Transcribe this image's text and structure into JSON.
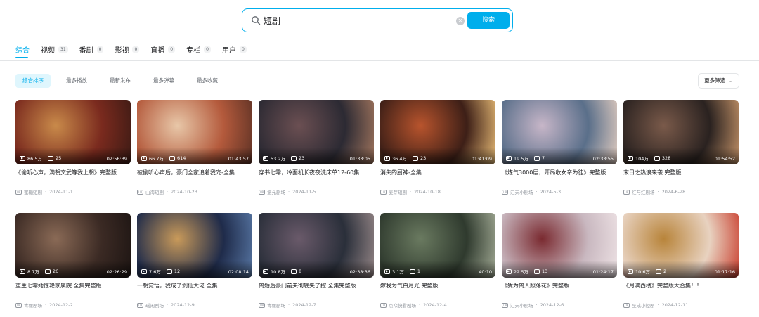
{
  "search": {
    "query": "短剧",
    "button_label": "搜索"
  },
  "tabs": [
    {
      "label": "综合",
      "count": ""
    },
    {
      "label": "视频",
      "count": "31"
    },
    {
      "label": "番剧",
      "count": "0"
    },
    {
      "label": "影视",
      "count": "0"
    },
    {
      "label": "直播",
      "count": "0"
    },
    {
      "label": "专栏",
      "count": "0"
    },
    {
      "label": "用户",
      "count": "0"
    }
  ],
  "sort_options": [
    "综合排序",
    "最多播放",
    "最新发布",
    "最多弹幕",
    "最多收藏"
  ],
  "more_filter_label": "更多筛选",
  "colors": {
    "accent": "#00aeec",
    "text": "#18191c",
    "muted": "#9499a0"
  },
  "videos": [
    {
      "views": "86.5万",
      "danmaku": "25",
      "duration": "02:56:39",
      "title": "《偷听心声，满朝文武等我上朝》完整版",
      "uploader": "蜜糖短剧",
      "date": "2024-11-1"
    },
    {
      "views": "66.7万",
      "danmaku": "614",
      "duration": "01:43:57",
      "title": "被偷听心声后，豪门全家追着我宠-全集",
      "uploader": "山海短剧",
      "date": "2024-10-23"
    },
    {
      "views": "53.2万",
      "danmaku": "23",
      "duration": "01:33:05",
      "title": "穿书七零，冷面机长夜夜洗床单12-60集",
      "uploader": "振允剧场",
      "date": "2024-11-5"
    },
    {
      "views": "36.4万",
      "danmaku": "23",
      "duration": "01:41:09",
      "title": "消失的厨神-全集",
      "uploader": "麦芽短剧",
      "date": "2024-10-18"
    },
    {
      "views": "19.5万",
      "danmaku": "7",
      "duration": "02:33:55",
      "title": "《炼气3000层，开局收女帝为徒》完整版",
      "uploader": "汇天小剧场",
      "date": "2024-5-3"
    },
    {
      "views": "104万",
      "danmaku": "328",
      "duration": "01:54:52",
      "title": "末日之热浪来袭 完整版",
      "uploader": "红与红剧场",
      "date": "2024-6-28"
    },
    {
      "views": "8.7万",
      "danmaku": "26",
      "duration": "02:26:29",
      "title": "重生七零她惊艳家属院 全集完整版",
      "uploader": "青稞剧场",
      "date": "2024-12-2"
    },
    {
      "views": "7.6万",
      "danmaku": "12",
      "duration": "02:08:14",
      "title": "一朝觉悟，我成了剑仙大佬 全集",
      "uploader": "瑶闲剧场",
      "date": "2024-12-9"
    },
    {
      "views": "10.8万",
      "danmaku": "8",
      "duration": "02:38:36",
      "title": "离婚后豪门前夫彻底失了控 全集完整版",
      "uploader": "青稞剧场",
      "date": "2024-12-7"
    },
    {
      "views": "3.1万",
      "danmaku": "1",
      "duration": "40:10",
      "title": "嫁我为气白月光 完整版",
      "uploader": "点众快看剧场",
      "date": "2024-12-4"
    },
    {
      "views": "22.5万",
      "danmaku": "13",
      "duration": "01:24:17",
      "title": "《犹为离人照落花》完整版",
      "uploader": "汇天小剧场",
      "date": "2024-12-6"
    },
    {
      "views": "10.6万",
      "danmaku": "2",
      "duration": "01:17:16",
      "title": "《月满西楼》完整版大合集！！",
      "uploader": "至成小短剧",
      "date": "2024-12-11"
    }
  ]
}
